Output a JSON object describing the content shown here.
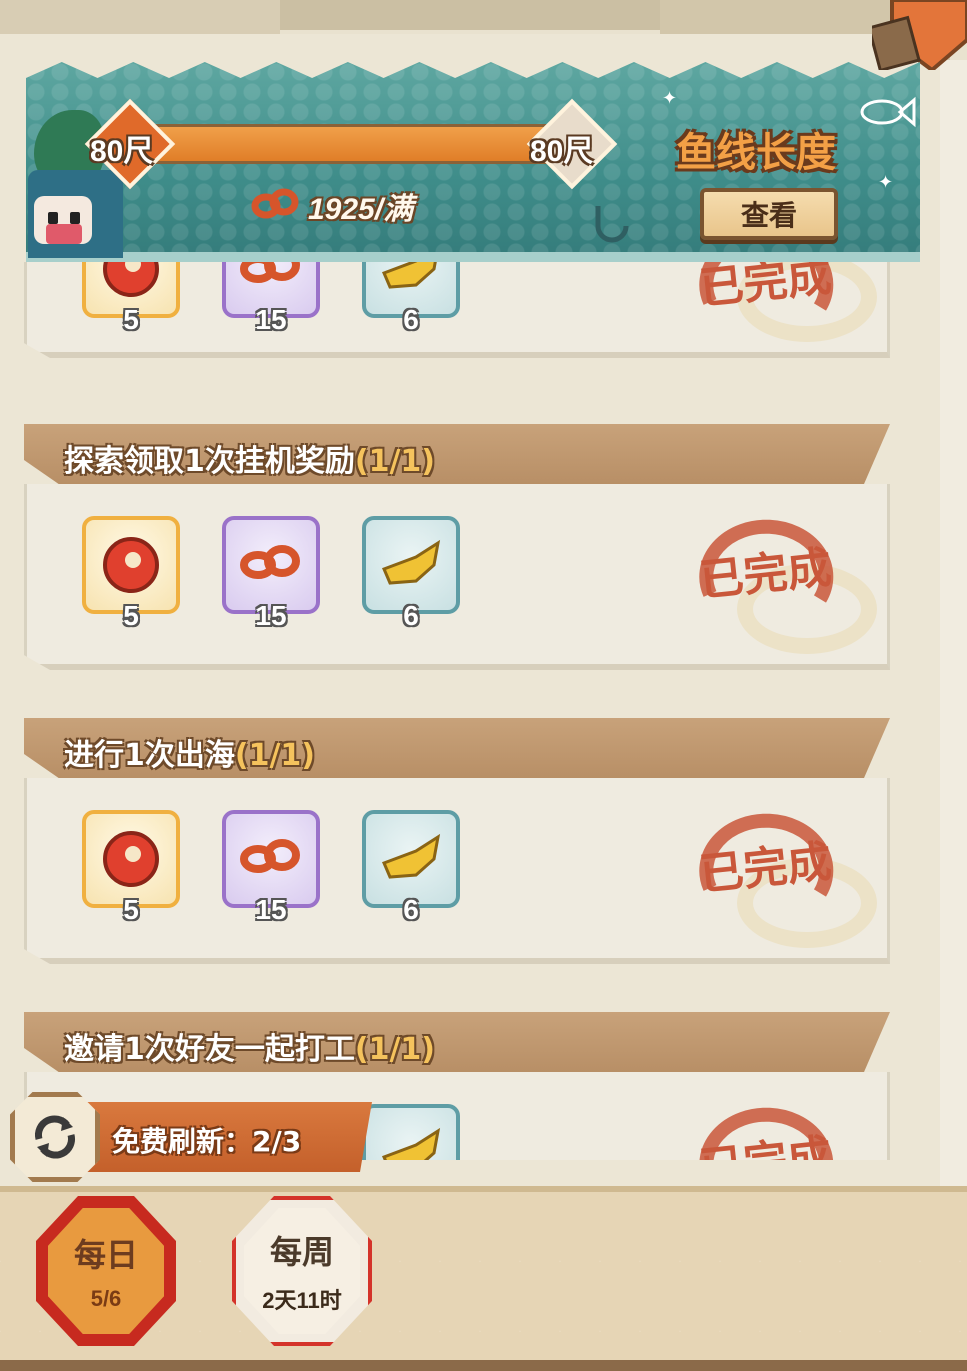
{
  "header": {
    "line_length_left": "80尺",
    "line_length_right": "80尺",
    "rope_count": "1925/满",
    "title": "鱼线长度",
    "view_button": "查看",
    "length_progress_fraction": 1.0
  },
  "tasks": [
    {
      "title": "",
      "progress": "",
      "rewards": [
        {
          "icon": "red-ticket-icon",
          "qty": "5"
        },
        {
          "icon": "rope-icon",
          "qty": "15"
        },
        {
          "icon": "fish-bait-icon",
          "qty": "6"
        }
      ],
      "status": "已完成"
    },
    {
      "title": "探索领取1次挂机奖励",
      "progress": "(1/1)",
      "rewards": [
        {
          "icon": "red-ticket-icon",
          "qty": "5"
        },
        {
          "icon": "rope-icon",
          "qty": "15"
        },
        {
          "icon": "fish-bait-icon",
          "qty": "6"
        }
      ],
      "status": "已完成"
    },
    {
      "title": "进行1次出海",
      "progress": "(1/1)",
      "rewards": [
        {
          "icon": "red-ticket-icon",
          "qty": "5"
        },
        {
          "icon": "rope-icon",
          "qty": "15"
        },
        {
          "icon": "fish-bait-icon",
          "qty": "6"
        }
      ],
      "status": "已完成"
    },
    {
      "title": "邀请1次好友一起打工",
      "progress": "(1/1)",
      "rewards": [
        {
          "icon": "fish-bait-icon",
          "qty": ""
        }
      ],
      "status": "已完成"
    }
  ],
  "refresh": {
    "label": "免费刷新：2/3"
  },
  "tabs": {
    "daily": {
      "title": "每日",
      "sub": "5/6"
    },
    "weekly": {
      "title": "每周",
      "sub": "2天11时"
    }
  },
  "colors": {
    "banner": "#3f8d8a",
    "accent_orange": "#e07e28",
    "stamp_red": "#c9573a",
    "header_brown": "#b88f66"
  }
}
